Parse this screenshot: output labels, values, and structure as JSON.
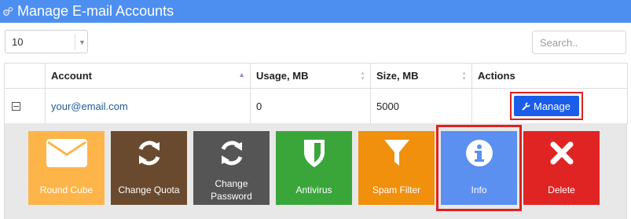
{
  "window": {
    "title": "Manage E-mail Accounts"
  },
  "controls": {
    "page_size": "10",
    "search_placeholder": "Search.."
  },
  "table": {
    "headers": {
      "account": "Account",
      "usage": "Usage, MB",
      "size": "Size, MB",
      "actions": "Actions"
    },
    "rows": [
      {
        "account": "your@email.com",
        "usage": "0",
        "size": "5000",
        "action_label": "Manage"
      }
    ]
  },
  "tiles": [
    {
      "label": "Round Cube",
      "icon": "envelope-icon",
      "color": "#fdb54a"
    },
    {
      "label": "Change Quota",
      "icon": "refresh-icon",
      "color": "#6a4a2e"
    },
    {
      "label": "Change Password",
      "icon": "refresh-icon",
      "color": "#555555"
    },
    {
      "label": "Antivirus",
      "icon": "shield-icon",
      "color": "#3aa63a"
    },
    {
      "label": "Spam Filter",
      "icon": "filter-icon",
      "color": "#f0900c"
    },
    {
      "label": "Info",
      "icon": "info-icon",
      "color": "#5b8ff0"
    },
    {
      "label": "Delete",
      "icon": "close-icon",
      "color": "#e02424"
    }
  ],
  "colors": {
    "titlebar": "#4d8ff0",
    "manage_button": "#1a5de8",
    "highlight_frame": "#e02020"
  }
}
